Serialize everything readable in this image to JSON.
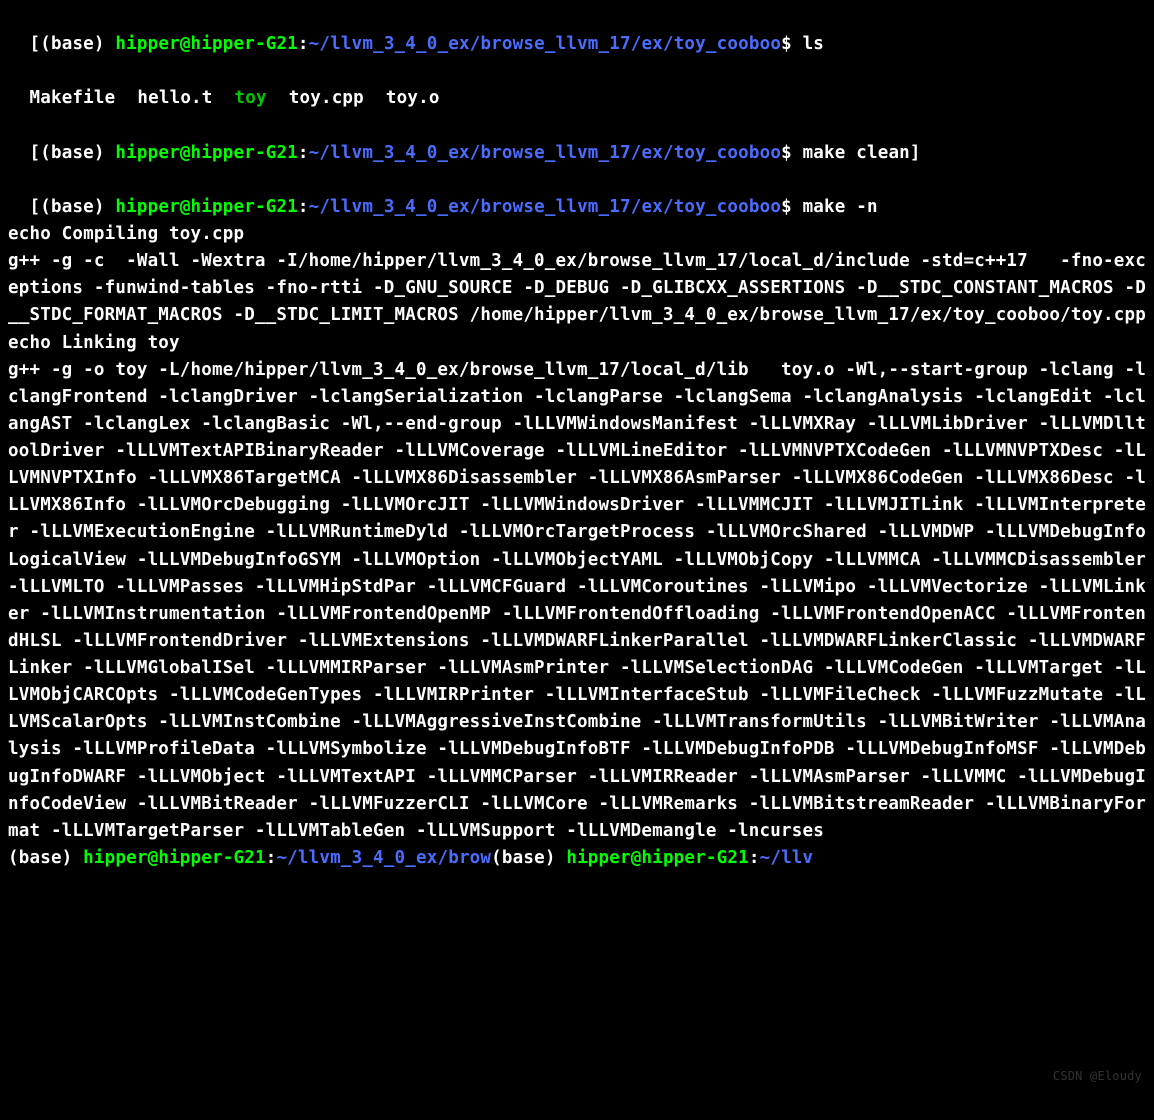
{
  "prompt": {
    "env": "(base)",
    "userhost": "hipper@hipper-G21",
    "cwd": "~/llvm_3_4_0_ex/browse_llvm_17/ex/toy_cooboo",
    "cwd_short": "~/llvm_3_4_0_ex/brow",
    "cwd_short2": "~/llv",
    "dollar": "$"
  },
  "cmd1": "ls",
  "ls": {
    "makefile": "Makefile",
    "hello": "hello.t",
    "toy": "toy",
    "toycpp": "toy.cpp",
    "toyo": "toy.o"
  },
  "cmd2": "make clean",
  "cmd3": "make -n",
  "make_output": "echo Compiling toy.cpp\ng++ -g -c  -Wall -Wextra -I/home/hipper/llvm_3_4_0_ex/browse_llvm_17/local_d/include -std=c++17   -fno-exceptions -funwind-tables -fno-rtti -D_GNU_SOURCE -D_DEBUG -D_GLIBCXX_ASSERTIONS -D__STDC_CONSTANT_MACROS -D__STDC_FORMAT_MACROS -D__STDC_LIMIT_MACROS /home/hipper/llvm_3_4_0_ex/browse_llvm_17/ex/toy_cooboo/toy.cpp\necho Linking toy\ng++ -g -o toy -L/home/hipper/llvm_3_4_0_ex/browse_llvm_17/local_d/lib   toy.o -Wl,--start-group -lclang -lclangFrontend -lclangDriver -lclangSerialization -lclangParse -lclangSema -lclangAnalysis -lclangEdit -lclangAST -lclangLex -lclangBasic -Wl,--end-group -lLLVMWindowsManifest -lLLVMXRay -lLLVMLibDriver -lLLVMDlltoolDriver -lLLVMTextAPIBinaryReader -lLLVMCoverage -lLLVMLineEditor -lLLVMNVPTXCodeGen -lLLVMNVPTXDesc -lLLVMNVPTXInfo -lLLVMX86TargetMCA -lLLVMX86Disassembler -lLLVMX86AsmParser -lLLVMX86CodeGen -lLLVMX86Desc -lLLVMX86Info -lLLVMOrcDebugging -lLLVMOrcJIT -lLLVMWindowsDriver -lLLVMMCJIT -lLLVMJITLink -lLLVMInterpreter -lLLVMExecutionEngine -lLLVMRuntimeDyld -lLLVMOrcTargetProcess -lLLVMOrcShared -lLLVMDWP -lLLVMDebugInfoLogicalView -lLLVMDebugInfoGSYM -lLLVMOption -lLLVMObjectYAML -lLLVMObjCopy -lLLVMMCA -lLLVMMCDisassembler -lLLVMLTO -lLLVMPasses -lLLVMHipStdPar -lLLVMCFGuard -lLLVMCoroutines -lLLVMipo -lLLVMVectorize -lLLVMLinker -lLLVMInstrumentation -lLLVMFrontendOpenMP -lLLVMFrontendOffloading -lLLVMFrontendOpenACC -lLLVMFrontendHLSL -lLLVMFrontendDriver -lLLVMExtensions -lLLVMDWARFLinkerParallel -lLLVMDWARFLinkerClassic -lLLVMDWARFLinker -lLLVMGlobalISel -lLLVMMIRParser -lLLVMAsmPrinter -lLLVMSelectionDAG -lLLVMCodeGen -lLLVMTarget -lLLVMObjCARCOpts -lLLVMCodeGenTypes -lLLVMIRPrinter -lLLVMInterfaceStub -lLLVMFileCheck -lLLVMFuzzMutate -lLLVMScalarOpts -lLLVMInstCombine -lLLVMAggressiveInstCombine -lLLVMTransformUtils -lLLVMBitWriter -lLLVMAnalysis -lLLVMProfileData -lLLVMSymbolize -lLLVMDebugInfoBTF -lLLVMDebugInfoPDB -lLLVMDebugInfoMSF -lLLVMDebugInfoDWARF -lLLVMObject -lLLVMTextAPI -lLLVMMCParser -lLLVMIRReader -lLLVMAsmParser -lLLVMMC -lLLVMDebugInfoCodeView -lLLVMBitReader -lLLVMFuzzerCLI -lLLVMCore -lLLVMRemarks -lLLVMBitstreamReader -lLLVMBinaryFormat -lLLVMTargetParser -lLLVMTableGen -lLLVMSupport -lLLVMDemangle -lncurses",
  "watermark": "CSDN @Eloudy"
}
